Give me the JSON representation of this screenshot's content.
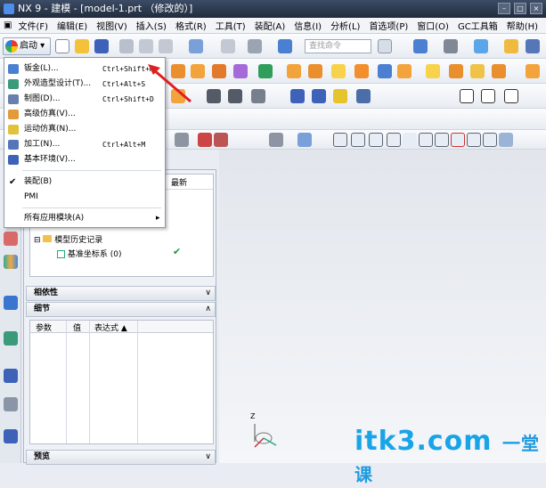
{
  "window": {
    "title": "NX 9 - 建模 - [model-1.prt （修改的）]",
    "min": "–",
    "max": "□",
    "close": "×"
  },
  "menu": [
    "文件(F)",
    "编辑(E)",
    "视图(V)",
    "插入(S)",
    "格式(R)",
    "工具(T)",
    "装配(A)",
    "信息(I)",
    "分析(L)",
    "首选项(P)",
    "窗口(O)",
    "GC工具箱",
    "帮助(H)"
  ],
  "toolbar": {
    "start_label": "启动",
    "search_placeholder": "查找命令"
  },
  "start_menu": [
    {
      "label": "钣金(L)...",
      "shortcut": "Ctrl+Shift+M"
    },
    {
      "label": "外观造型设计(T)...",
      "shortcut": "Ctrl+Alt+S"
    },
    {
      "label": "制图(D)...",
      "shortcut": "Ctrl+Shift+D"
    },
    {
      "label": "高级仿真(V)...",
      "shortcut": ""
    },
    {
      "label": "运动仿真(N)...",
      "shortcut": ""
    },
    {
      "label": "加工(N)...",
      "shortcut": "Ctrl+Alt+M"
    },
    {
      "label": "基本环境(V)...",
      "shortcut": ""
    },
    {
      "label": "装配(B)",
      "shortcut": ""
    },
    {
      "label": "PMI",
      "shortcut": ""
    },
    {
      "label": "所有应用模块(A)",
      "shortcut": ""
    }
  ],
  "part_navigator": {
    "col_latest": "最新",
    "node_history": "模型历史记录",
    "node_csys": "基准坐标系 (0)"
  },
  "panels": {
    "dependency": "相依性",
    "details": "细节",
    "preview": "预览"
  },
  "details_columns": [
    "参数",
    "值",
    "表达式 ▲"
  ],
  "graphics": {
    "axis_label": "Z"
  },
  "watermark": "itk3.com",
  "watermark_cn": "一堂课"
}
